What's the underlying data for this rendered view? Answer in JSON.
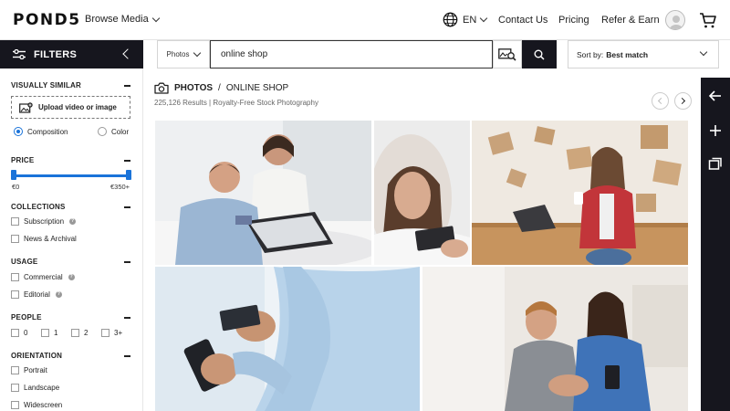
{
  "header": {
    "logo": "POND5",
    "browse_label": "Browse Media",
    "lang_label": "EN",
    "nav": [
      "Contact Us",
      "Pricing",
      "Refer & Earn"
    ]
  },
  "filters": {
    "title": "FILTERS",
    "visually_similar": {
      "title": "VISUALLY SIMILAR",
      "upload_label": "Upload video or image",
      "options": [
        "Composition",
        "Color"
      ],
      "selected": "Composition"
    },
    "price": {
      "title": "PRICE",
      "min_label": "€0",
      "max_label": "€350+",
      "range": [
        0,
        350
      ]
    },
    "collections": {
      "title": "COLLECTIONS",
      "items": [
        "Subscription",
        "News & Archival"
      ]
    },
    "usage": {
      "title": "USAGE",
      "items": [
        "Commercial",
        "Editorial"
      ]
    },
    "people": {
      "title": "PEOPLE",
      "items": [
        "0",
        "1",
        "2",
        "3+"
      ]
    },
    "orientation": {
      "title": "ORIENTATION",
      "items": [
        "Portrait",
        "Landscape",
        "Widescreen"
      ]
    }
  },
  "search": {
    "type_label": "Photos",
    "query": "online shop",
    "sort_prefix": "Sort by:",
    "sort_value": "Best match"
  },
  "results": {
    "media_type": "PHOTOS",
    "separator": "/",
    "query_label": "ONLINE SHOP",
    "summary": "225,126 Results | Royalty-Free Stock Photography"
  },
  "colors": {
    "accent": "#1a73d9",
    "dark": "#16161e"
  }
}
